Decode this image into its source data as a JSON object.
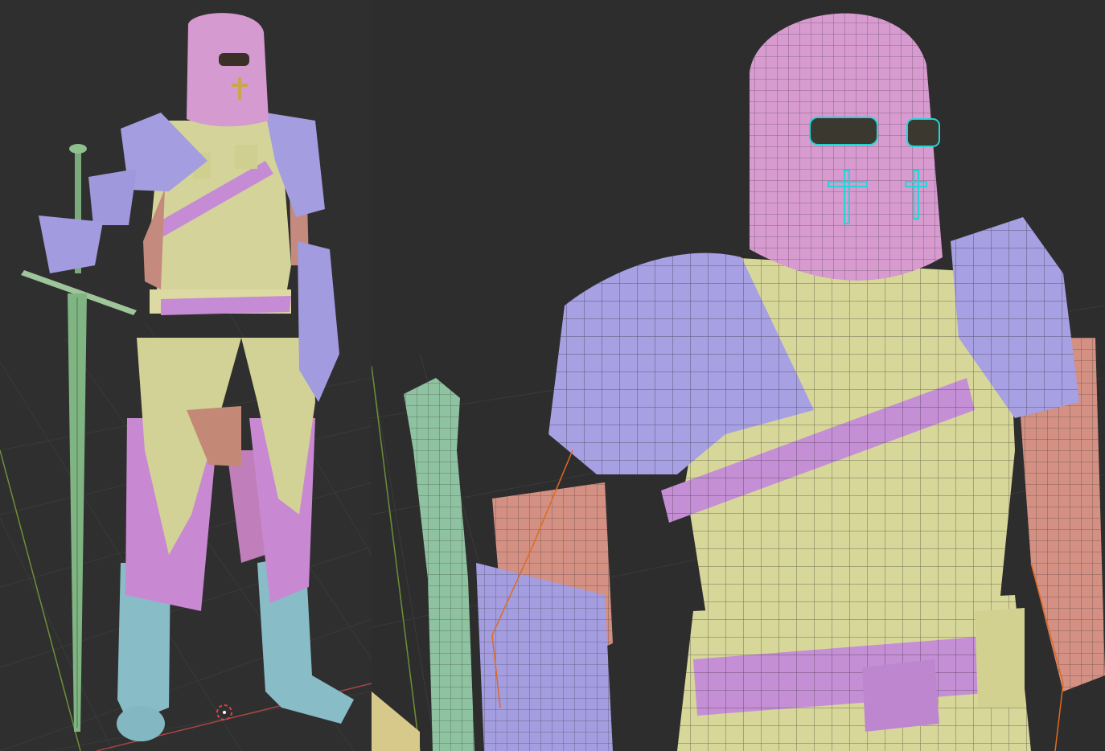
{
  "viewports": [
    {
      "id": "left",
      "mode": "solid",
      "description": ""
    },
    {
      "id": "right",
      "mode": "wireframe-overlay",
      "description": ""
    }
  ],
  "palette": {
    "background": "#2e2e2e",
    "grid": "#3d3d3d",
    "helmet": "#d99ad0",
    "pauldron": "#a8a0e0",
    "torso": "#d8d89a",
    "belt": "#c48fd6",
    "skin": "#c98c80",
    "sword": "#86b888",
    "boots": "#8cc0c8",
    "accent_cyan": "#22d6d6",
    "axis_red": "#b84848",
    "axis_green": "#7a9a3a",
    "selection_orange": "#e06a20"
  }
}
